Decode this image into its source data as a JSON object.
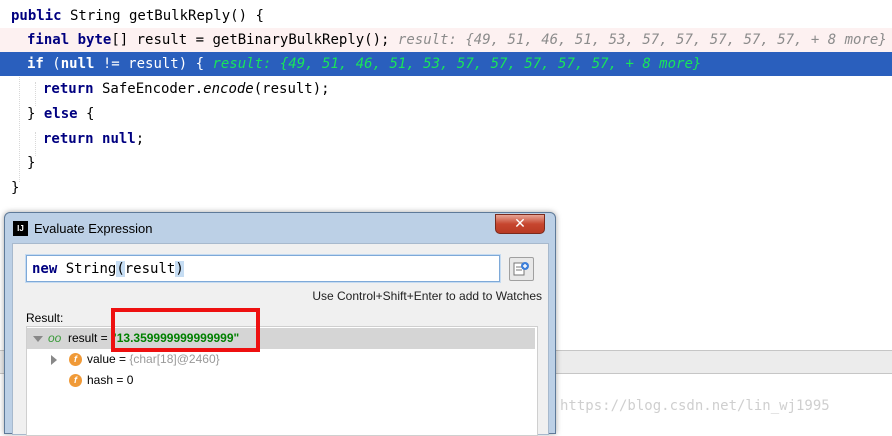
{
  "editor": {
    "lines": [
      {
        "kw1": "public",
        "t1": " String getBulkReply() {"
      },
      {
        "kw1": "final",
        "sp": " ",
        "kw2": "byte",
        "t1": "[] result = getBinaryBulkReply();",
        "hint": "result: {49, 51, 46, 51, 53, 57, 57, 57, 57, 57, + 8 more}"
      },
      {
        "kw1": "if",
        "t1": " (",
        "kw2": "null",
        "t2": " != result) {",
        "hint": "result: {49, 51, 46, 51, 53, 57, 57, 57, 57, 57, + 8 more}"
      },
      {
        "kw1": "return",
        "t1": " SafeEncoder.",
        "it": "encode",
        "t2": "(result);"
      },
      {
        "t1": "} ",
        "kw1": "else",
        "t2": " {"
      },
      {
        "kw1": "return",
        "sp": " ",
        "kw2": "null",
        "t1": ";"
      },
      {
        "t1": "}"
      },
      {
        "t1": "}"
      }
    ],
    "watermark": "https://blog.csdn.net/lin_wj1995"
  },
  "dialog": {
    "title": "Evaluate Expression",
    "app_icon": "IJ",
    "close_glyph": "✕",
    "expression": {
      "kw": "new",
      "t1": " String",
      "open": "(",
      "arg": "result",
      "close": ")"
    },
    "watches_hint": "Use Control+Shift+Enter to add to Watches",
    "result_label": "Result:",
    "result": {
      "root": {
        "name": "result",
        "eq": " = ",
        "value": "\"13.359999999999999\"",
        "icon": "oo-icon"
      },
      "children": [
        {
          "name": "value",
          "eq": " = ",
          "value": "{char[18]@2460}",
          "icon": "field-icon",
          "glyph": "f"
        },
        {
          "name": "hash",
          "eq": " = ",
          "value": "0",
          "icon": "field-icon",
          "glyph": "f"
        }
      ]
    }
  }
}
